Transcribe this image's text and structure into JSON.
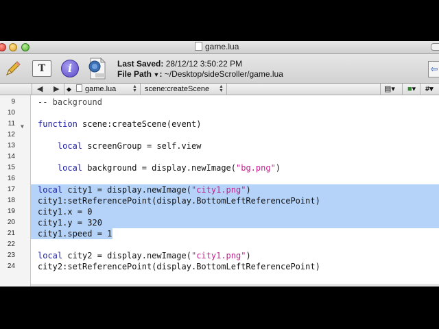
{
  "window": {
    "title": "game.lua"
  },
  "toolbar": {
    "text_button_label": "T",
    "info_button_label": "i",
    "last_saved_label": "Last Saved:",
    "last_saved_value": "28/12/12 3:50:22 PM",
    "file_path_label": "File Path",
    "file_path_value": "~/Desktop/sideScroller/game.lua"
  },
  "navbar": {
    "file_name": "game.lua",
    "function_name": "scene:createScene"
  },
  "editor": {
    "lines": [
      {
        "num": "9",
        "segments": [
          {
            "t": "-- background",
            "c": "cmt"
          }
        ]
      },
      {
        "num": "10",
        "segments": []
      },
      {
        "num": "11",
        "fold": true,
        "segments": [
          {
            "t": "function",
            "c": "kw"
          },
          {
            "t": " scene:createScene(event)",
            "c": ""
          }
        ]
      },
      {
        "num": "12",
        "segments": []
      },
      {
        "num": "13",
        "segments": [
          {
            "t": "    ",
            "c": ""
          },
          {
            "t": "local",
            "c": "kw"
          },
          {
            "t": " screenGroup = self.view",
            "c": ""
          }
        ]
      },
      {
        "num": "14",
        "segments": []
      },
      {
        "num": "15",
        "segments": [
          {
            "t": "    ",
            "c": ""
          },
          {
            "t": "local",
            "c": "kw"
          },
          {
            "t": " background = display.newImage(",
            "c": ""
          },
          {
            "t": "\"bg.png\"",
            "c": "str"
          },
          {
            "t": ")",
            "c": ""
          }
        ]
      },
      {
        "num": "16",
        "segments": []
      },
      {
        "num": "17",
        "selected": true,
        "segments": [
          {
            "t": "local",
            "c": "kw"
          },
          {
            "t": " city1 = display.newImage(",
            "c": ""
          },
          {
            "t": "\"city1.png\"",
            "c": "str"
          },
          {
            "t": ")",
            "c": ""
          }
        ]
      },
      {
        "num": "18",
        "selected": true,
        "segments": [
          {
            "t": "city1:setReferencePoint(display.BottomLeftReferencePoint)",
            "c": ""
          }
        ]
      },
      {
        "num": "19",
        "selected": true,
        "segments": [
          {
            "t": "city1.x = 0",
            "c": ""
          }
        ]
      },
      {
        "num": "20",
        "selected": true,
        "segments": [
          {
            "t": "city1.y = 320",
            "c": ""
          }
        ]
      },
      {
        "num": "21",
        "selected": true,
        "partial": true,
        "segments": [
          {
            "t": "city1.speed = 1",
            "c": ""
          }
        ]
      },
      {
        "num": "22",
        "segments": []
      },
      {
        "num": "23",
        "segments": [
          {
            "t": "local",
            "c": "kw"
          },
          {
            "t": " city2 = display.newImage(",
            "c": ""
          },
          {
            "t": "\"city1.png\"",
            "c": "str"
          },
          {
            "t": ")",
            "c": ""
          }
        ]
      },
      {
        "num": "24",
        "segments": [
          {
            "t": "city2:setReferencePoint(display.BottomLeftReferencePoint)",
            "c": ""
          }
        ]
      }
    ]
  }
}
